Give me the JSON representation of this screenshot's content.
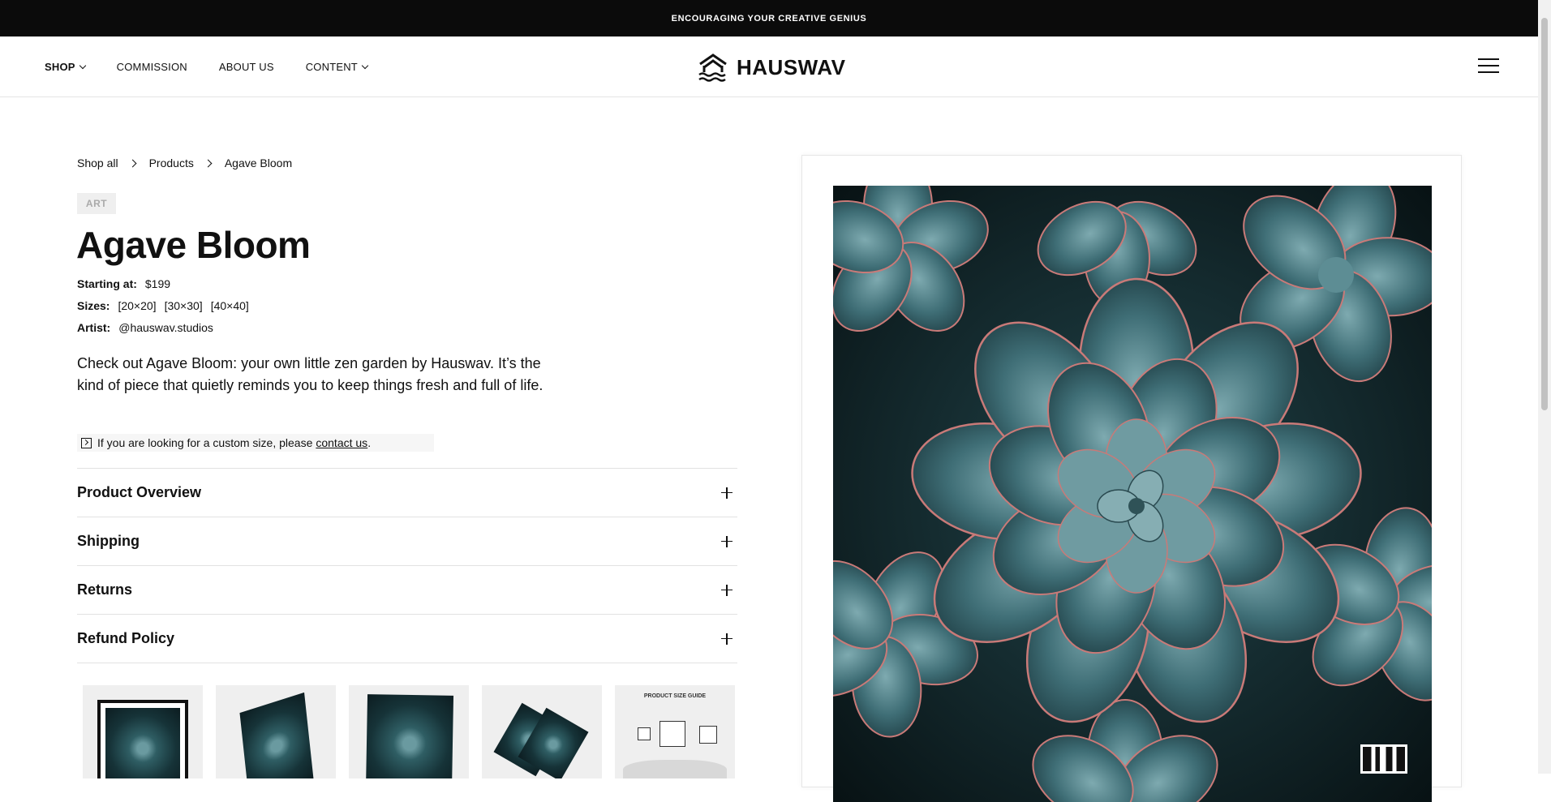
{
  "announcement": "ENCOURAGING YOUR CREATIVE GENIUS",
  "nav": {
    "items": [
      {
        "label": "SHOP",
        "dropdown": true
      },
      {
        "label": "COMMISSION",
        "dropdown": false
      },
      {
        "label": "ABOUT US",
        "dropdown": false
      },
      {
        "label": "CONTENT",
        "dropdown": true
      }
    ]
  },
  "brand": {
    "name": "HAUSWAV"
  },
  "breadcrumb": [
    "Shop all",
    "Products",
    "Agave Bloom"
  ],
  "product": {
    "tag": "ART",
    "title": "Agave Bloom",
    "price_label": "Starting at:",
    "price": "$199",
    "sizes_label": "Sizes:",
    "sizes": [
      "[20×20]",
      "[30×30]",
      "[40×40]"
    ],
    "artist_label": "Artist:",
    "artist": "@hauswav.studios",
    "description": "Check out Agave Bloom: your own little zen garden by Hauswav. It’s the kind of piece that quietly reminds you to keep things fresh and full of life.",
    "notice_text": "If you are looking for a custom size, please",
    "notice_link": "contact us",
    "notice_end": "."
  },
  "accordion": [
    "Product Overview",
    "Shipping",
    "Returns",
    "Refund Policy"
  ],
  "thumbnails": {
    "size_guide_title": "PRODUCT SIZE GUIDE"
  },
  "colors": {
    "announcement_bg": "#0b0b0b",
    "text": "#111111",
    "succulent_teal": "#3f6e76",
    "succulent_edge": "#c97a78"
  }
}
